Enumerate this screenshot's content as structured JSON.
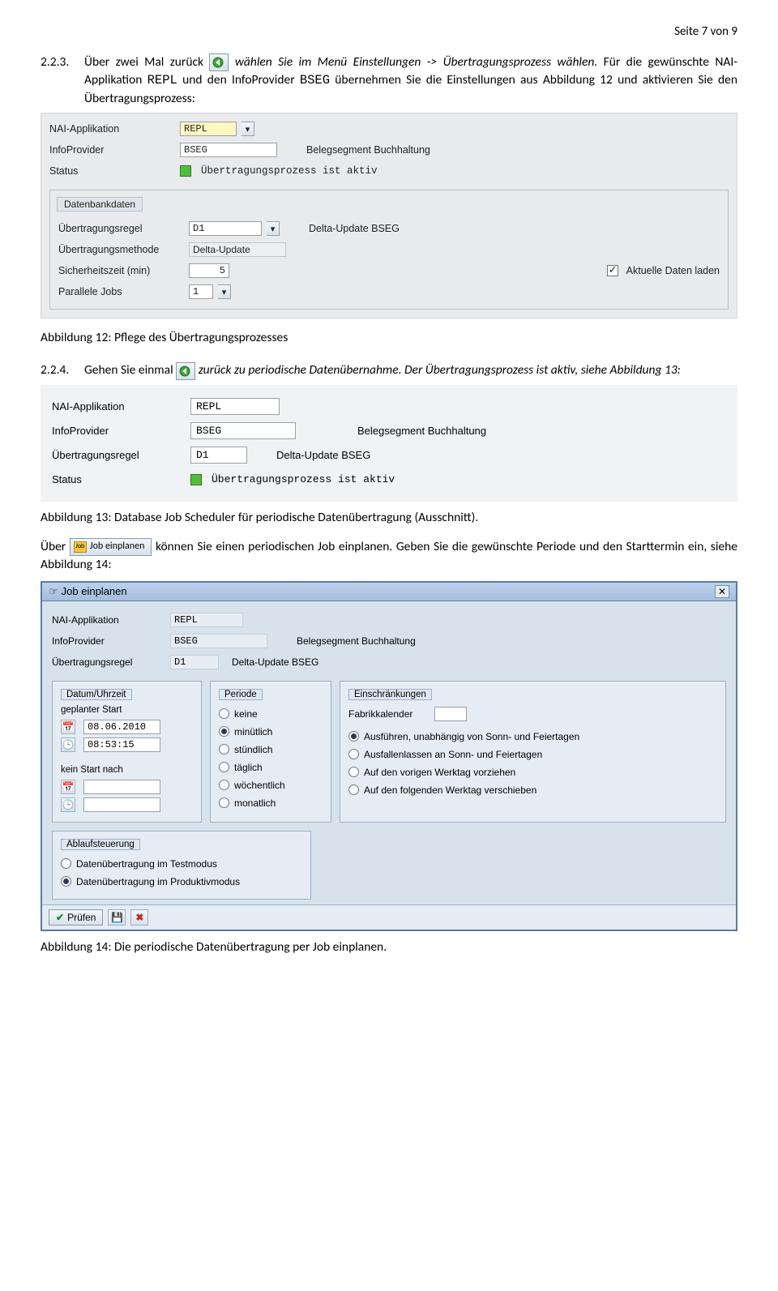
{
  "header": {
    "page_text": "Seite 7 von 9"
  },
  "p1": {
    "num": "2.2.3.",
    "pre": "Über zwei Mal zurück ",
    "post": " wählen Sie im Menü Einstellungen -> Übertragungsprozess wählen.",
    "line2a": "Für die gewünschte NAI-Applikation ",
    "code1": "REPL",
    "line2b": " und den InfoProvider ",
    "code2": "BSEG",
    "line2c": " übernehmen Sie die Einstellungen aus Abbildung 12 und aktivieren Sie den Übertragungsprozess:"
  },
  "sap1": {
    "rows": {
      "nai_label": "NAI-Applikation",
      "nai_value": "REPL",
      "ip_label": "InfoProvider",
      "ip_value": "BSEG",
      "ip_desc": "Belegsegment Buchhaltung",
      "st_label": "Status",
      "st_text": "Übertragungsprozess ist aktiv"
    },
    "group_title": "Datenbankdaten",
    "group": {
      "regel_label": "Übertragungsregel",
      "regel_value": "D1",
      "regel_desc": "Delta-Update BSEG",
      "meth_label": "Übertragungsmethode",
      "meth_value": "Delta-Update",
      "sich_label": "Sicherheitszeit (min)",
      "sich_value": "5",
      "akt_label": "Aktuelle Daten laden",
      "par_label": "Parallele Jobs",
      "par_value": "1"
    }
  },
  "caption12": "Abbildung 12: Pflege des Übertragungsprozesses",
  "p2": {
    "num": "2.2.4.",
    "pre": "Gehen Sie einmal ",
    "post": " zurück zu periodische Datenübernahme. Der Übertragungsprozess ist aktiv, siehe Abbildung 13:"
  },
  "sap2": {
    "nai_label": "NAI-Applikation",
    "nai_value": "REPL",
    "ip_label": "InfoProvider",
    "ip_value": "BSEG",
    "ip_desc": "Belegsegment Buchhaltung",
    "regel_label": "Übertragungsregel",
    "regel_value": "D1",
    "regel_desc": "Delta-Update BSEG",
    "st_label": "Status",
    "st_text": "Übertragungsprozess ist aktiv"
  },
  "caption13": "Abbildung 13: Database Job Scheduler für periodische Datenübertragung (Ausschnitt).",
  "p3": {
    "pre": "Über ",
    "btn": "Job einplanen",
    "post": " können Sie einen periodischen Job einplanen. Geben Sie die gewünschte Periode und den Starttermin ein, siehe Abbildung 14:"
  },
  "dialog": {
    "title": "Job einplanen",
    "head": {
      "nai_label": "NAI-Applikation",
      "nai_value": "REPL",
      "ip_label": "InfoProvider",
      "ip_value": "BSEG",
      "ip_desc": "Belegsegment Buchhaltung",
      "regel_label": "Übertragungsregel",
      "regel_value": "D1",
      "regel_desc": "Delta-Update BSEG"
    },
    "g1": {
      "title": "Datum/Uhrzeit",
      "plan_label": "geplanter Start",
      "date": "08.06.2010",
      "time": "08:53:15",
      "nostart_label": "kein Start nach"
    },
    "g2": {
      "title": "Periode",
      "opts": [
        "keine",
        "minütlich",
        "stündlich",
        "täglich",
        "wöchentlich",
        "monatlich"
      ],
      "selected": 1
    },
    "g3": {
      "title": "Einschränkungen",
      "kal_label": "Fabrikkalender",
      "opts": [
        "Ausführen, unabhängig von Sonn- und Feiertagen",
        "Ausfallenlassen an Sonn- und Feiertagen",
        "Auf den vorigen Werktag vorziehen",
        "Auf den folgenden Werktag verschieben"
      ],
      "selected": 0
    },
    "g4": {
      "title": "Ablaufsteuerung",
      "opts": [
        "Datenübertragung im Testmodus",
        "Datenübertragung im Produktivmodus"
      ],
      "selected": 1
    },
    "footer": {
      "check_label": "Prüfen"
    }
  },
  "caption14": "Abbildung 14: Die periodische Datenübertragung per Job einplanen."
}
